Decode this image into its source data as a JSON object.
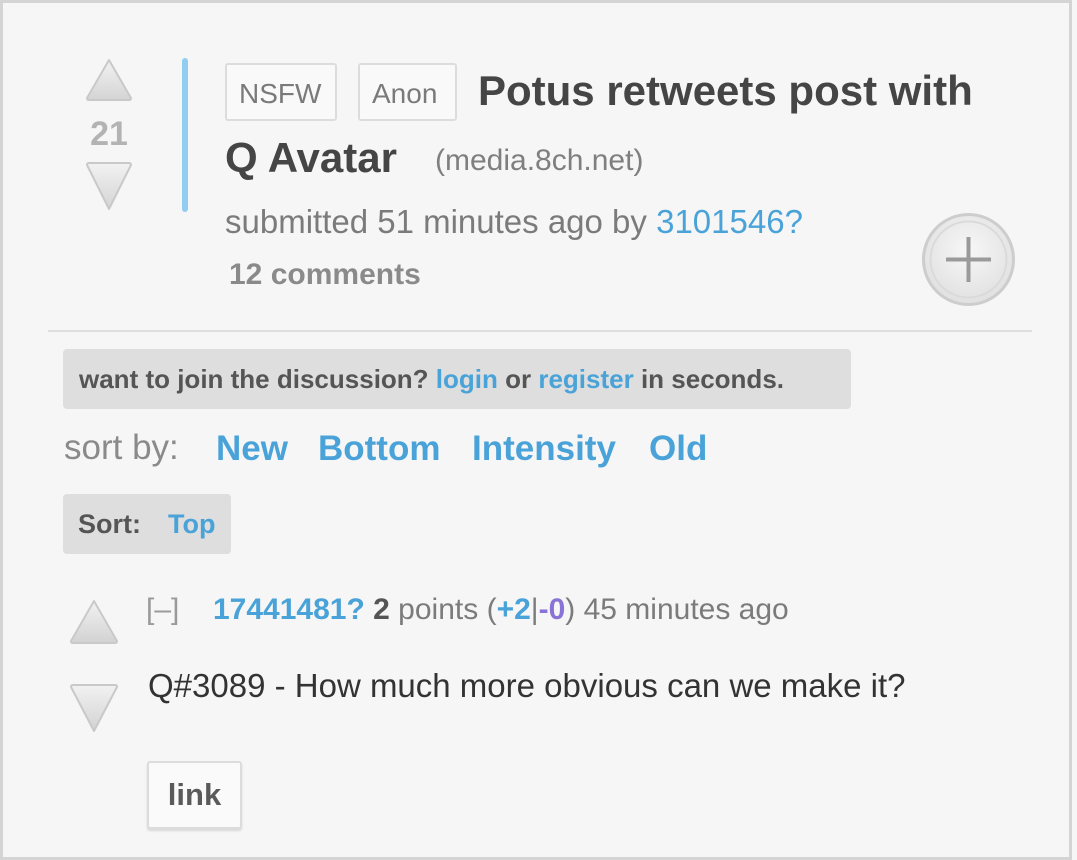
{
  "post": {
    "score": "21",
    "tags": [
      "NSFW",
      "Anon"
    ],
    "title_line1": "Potus retweets post with",
    "title_line2": "Q Avatar",
    "domain": "(media.8ch.net)",
    "submitted_prefix": "submitted 51 minutes ago by ",
    "author": "3101546?",
    "comments": "12 comments",
    "expand_icon": "plus-circle-icon"
  },
  "login_notice": {
    "prefix": "want to join the discussion? ",
    "login": "login",
    "or": " or ",
    "register": "register",
    "suffix": " in seconds."
  },
  "sort": {
    "label": "sort by:",
    "options": [
      "New",
      "Bottom",
      "Intensity",
      "Old"
    ],
    "current_label": "Sort:",
    "current_value": "Top"
  },
  "comment": {
    "collapse": "[–]",
    "author": "17441481?",
    "points_num": "2",
    "points_word": " points (",
    "plus": "+2",
    "sep": "|",
    "minus": "-0",
    "time": ") 45 minutes ago",
    "body": "Q#3089 - How much more obvious can we make it?",
    "link_label": "link"
  },
  "colors": {
    "link": "#4aa3d8",
    "accent_bar": "#8fcdf1",
    "background": "#f6f6f6"
  }
}
